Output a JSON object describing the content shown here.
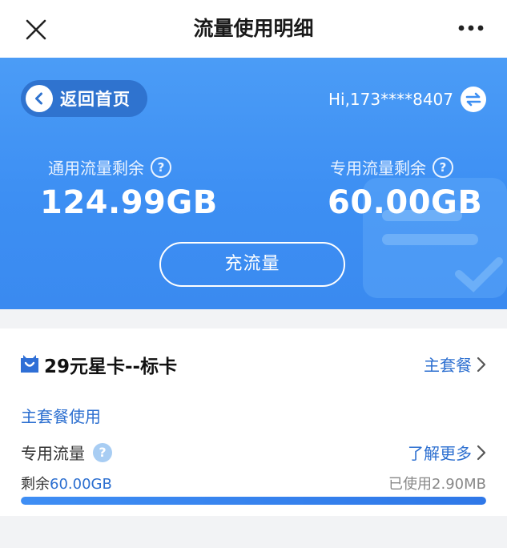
{
  "navbar": {
    "title": "流量使用明细",
    "close_icon": "close-icon",
    "more_icon": "more-dots-icon"
  },
  "hero": {
    "back_label": "返回首页",
    "greeting": "Hi,173****8407",
    "general": {
      "label": "通用流量剩余",
      "value": "124.99GB"
    },
    "dedicated": {
      "label": "专用流量剩余",
      "value": "60.00GB"
    },
    "recharge_label": "充流量",
    "accent": "#3d8ff3"
  },
  "package": {
    "title": "29元星卡--标卡",
    "main_plan_link": "主套餐",
    "section_title": "主套餐使用",
    "flow_label": "专用流量",
    "learn_more": "了解更多",
    "remain_prefix": "剩余",
    "remain_value": "60.00GB",
    "used_text": "已使用2.90MB",
    "remaining_fraction": 0.99995
  },
  "colors": {
    "link": "#2c6fd0",
    "background": "#f2f3f5"
  }
}
